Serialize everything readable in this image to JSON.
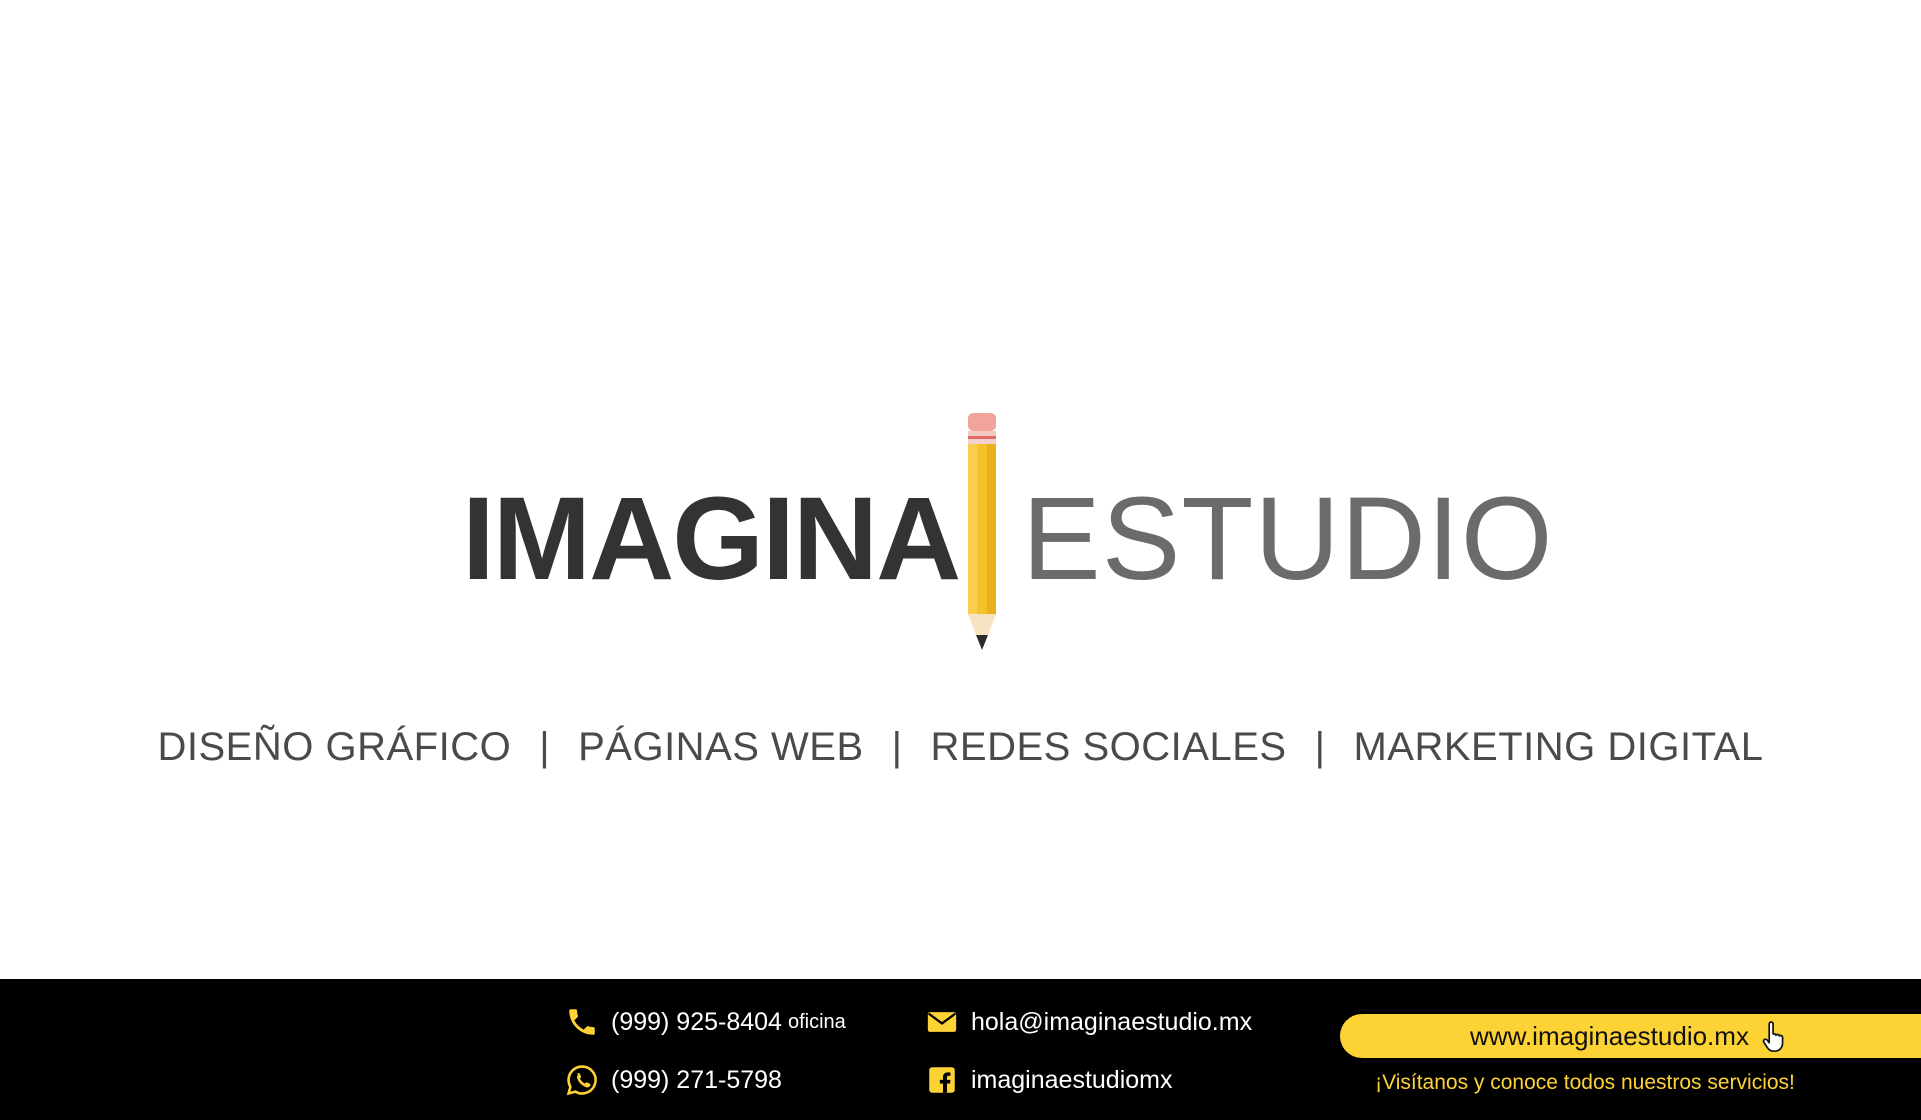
{
  "logo": {
    "word1": "IMAGINA",
    "word2": "ESTUDIO"
  },
  "services": [
    "DISEÑO GRÁFICO",
    "PÁGINAS WEB",
    "REDES SOCIALES",
    "MARKETING DIGITAL"
  ],
  "separator": "|",
  "footer": {
    "phone": "(999) 925-8404",
    "phone_note": "oficina",
    "whatsapp": "(999) 271-5798",
    "email": "hola@imaginaestudio.mx",
    "facebook": "imaginaestudiomx",
    "website": "www.imaginaestudio.mx",
    "tagline": "¡Visítanos y conoce todos nuestros servicios!"
  },
  "colors": {
    "accent": "#fdd235",
    "dark_text": "#333333",
    "gray_text": "#6b6b6b",
    "footer_bg": "#000000"
  },
  "icons": {
    "phone": "phone-icon",
    "whatsapp": "whatsapp-icon",
    "email": "envelope-icon",
    "facebook": "facebook-icon",
    "pointer": "hand-pointer-icon",
    "logo_mark": "pencil-icon"
  }
}
